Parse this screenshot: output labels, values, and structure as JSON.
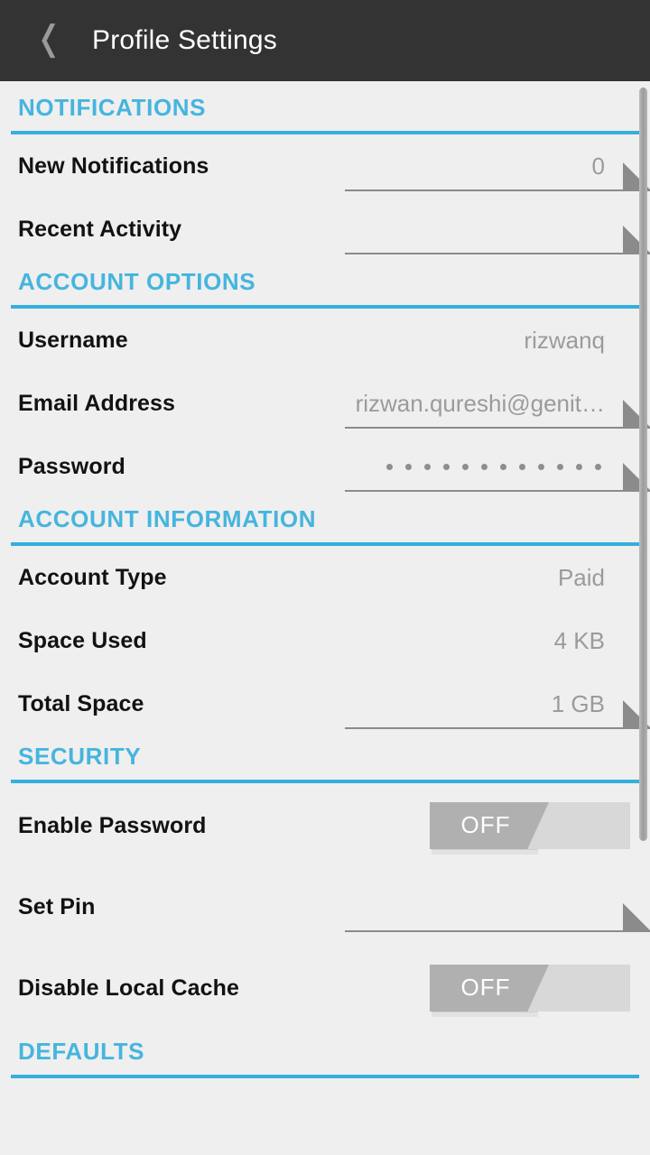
{
  "header": {
    "back_icon": "chevron-left-icon",
    "title": "Profile Settings"
  },
  "sections": [
    {
      "title": "NOTIFICATIONS",
      "rows": [
        {
          "label": "New Notifications",
          "value": "0",
          "type": "field"
        },
        {
          "label": "Recent Activity",
          "value": "",
          "type": "field"
        }
      ]
    },
    {
      "title": "ACCOUNT OPTIONS",
      "rows": [
        {
          "label": "Username",
          "value": "rizwanq",
          "type": "readonly"
        },
        {
          "label": "Email Address",
          "value": "rizwan.qureshi@genit…",
          "type": "field"
        },
        {
          "label": "Password",
          "value": "••••••••••••",
          "type": "password",
          "dot_count": 12
        }
      ]
    },
    {
      "title": "ACCOUNT INFORMATION",
      "rows": [
        {
          "label": "Account Type",
          "value": "Paid",
          "type": "readonly"
        },
        {
          "label": "Space Used",
          "value": "4 KB",
          "type": "readonly"
        },
        {
          "label": "Total Space",
          "value": "1 GB",
          "type": "field"
        }
      ]
    },
    {
      "title": "SECURITY",
      "rows": [
        {
          "label": "Enable Password",
          "value": "OFF",
          "type": "switch"
        },
        {
          "label": "Set Pin",
          "value": "",
          "type": "field"
        },
        {
          "label": "Disable Local Cache",
          "value": "OFF",
          "type": "switch"
        }
      ]
    },
    {
      "title": "DEFAULTS",
      "rows": []
    }
  ],
  "colors": {
    "accent": "#45b5de",
    "accent_rule": "#35afdc",
    "appbar": "#333333",
    "background": "#efefef",
    "label": "#121212",
    "value": "#9b9b9b",
    "switch_off_thumb": "#b0b0b0",
    "switch_track": "#d8d8d8"
  }
}
